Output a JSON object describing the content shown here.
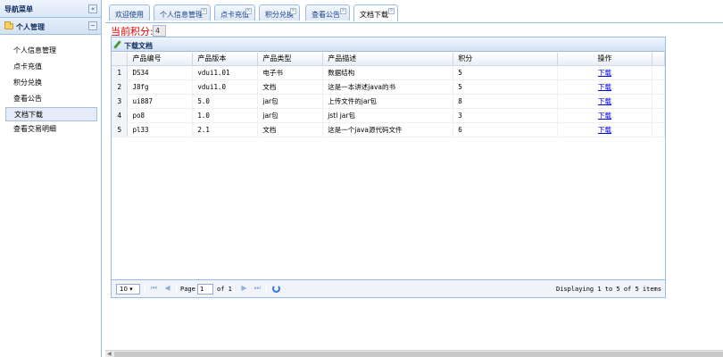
{
  "nav": {
    "title": "导航菜单",
    "collapse_icon": "«",
    "group": {
      "label": "个人管理",
      "collapse_icon": "−"
    },
    "items": [
      {
        "label": "个人信息管理"
      },
      {
        "label": "点卡充值"
      },
      {
        "label": "积分兑换"
      },
      {
        "label": "查看公告"
      },
      {
        "label": "文档下载"
      },
      {
        "label": "查看交易明细"
      }
    ]
  },
  "tabs": [
    {
      "label": "欢迎使用",
      "closable": false
    },
    {
      "label": "个人信息管理",
      "closable": true
    },
    {
      "label": "点卡充值",
      "closable": true
    },
    {
      "label": "积分兑换",
      "closable": true
    },
    {
      "label": "查看公告",
      "closable": true
    },
    {
      "label": "文档下载",
      "closable": true
    }
  ],
  "tab_close_glyph": "×",
  "points": {
    "label": "当前积分:",
    "value": "4"
  },
  "grid": {
    "title": "下载文档",
    "columns": [
      "产品编号",
      "产品版本",
      "产品类型",
      "产品描述",
      "积分",
      "操作"
    ],
    "rows": [
      {
        "n": "1",
        "id": "DS34",
        "ver": "vdui1.01",
        "type": "电子书",
        "desc": "数据结构",
        "score": "5",
        "action": "下载"
      },
      {
        "n": "2",
        "id": "J8fg",
        "ver": "vdui1.0",
        "type": "文档",
        "desc": "这是一本讲述java的书",
        "score": "5",
        "action": "下载"
      },
      {
        "n": "3",
        "id": "ui887",
        "ver": "5.0",
        "type": "jar包",
        "desc": "上传文件的jar包",
        "score": "8",
        "action": "下载"
      },
      {
        "n": "4",
        "id": "po8",
        "ver": "1.0",
        "type": "jar包",
        "desc": "jstl jar包",
        "score": "3",
        "action": "下载"
      },
      {
        "n": "5",
        "id": "pl33",
        "ver": "2.1",
        "type": "文档",
        "desc": "这是一个java源代码文件",
        "score": "6",
        "action": "下载"
      }
    ]
  },
  "pager": {
    "page_size": "10 ▾",
    "page_label": "Page",
    "page_value": "1",
    "of_label": "of 1",
    "display_text": "Displaying 1 to 5 of 5 items"
  },
  "colors": {
    "accent": "#99bbe8",
    "points_label": "#e60000",
    "link": "#0000ee"
  }
}
